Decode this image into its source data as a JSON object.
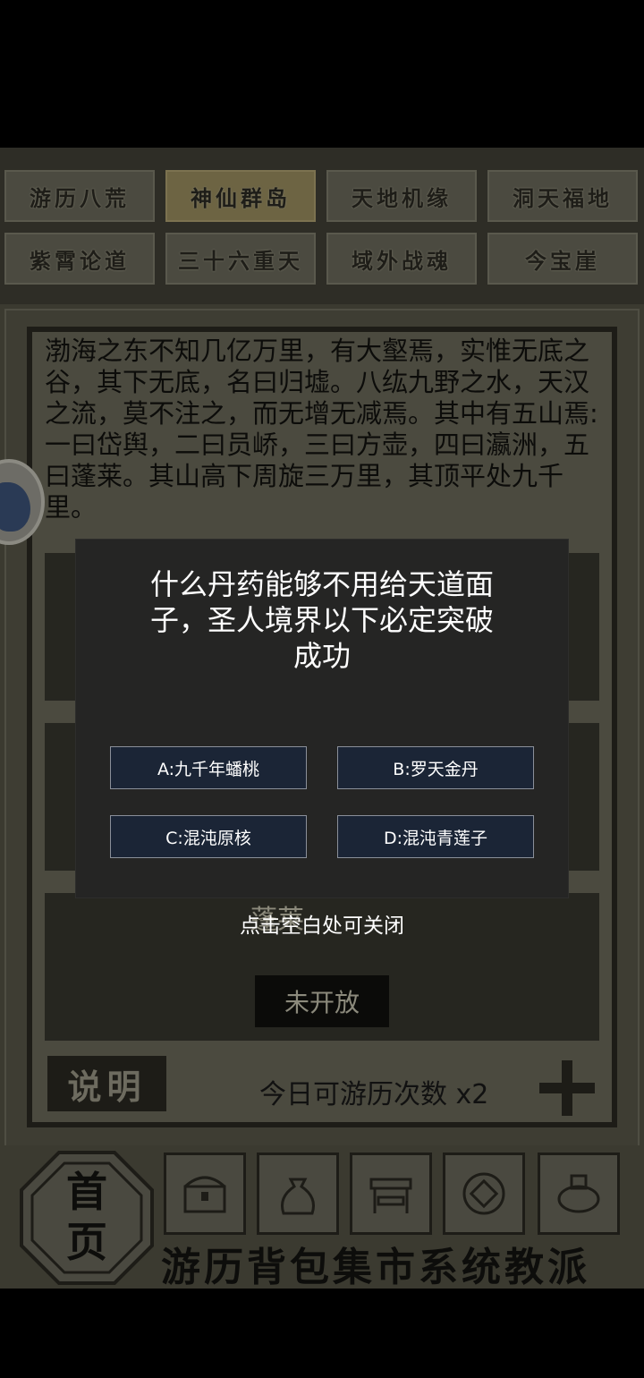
{
  "tabs": [
    {
      "label": "游历八荒"
    },
    {
      "label": "神仙群岛"
    },
    {
      "label": "天地机缘"
    },
    {
      "label": "洞天福地"
    },
    {
      "label": "紫霄论道"
    },
    {
      "label": "三十六重天"
    },
    {
      "label": "域外战魂"
    },
    {
      "label": "今宝崖"
    }
  ],
  "active_tab": "神仙群岛",
  "story_text": "渤海之东不知几亿万里，有大壑焉，实惟无底之谷，其下无底，名曰归墟。八纮九野之水，天汉之流，莫不注之，而无增无减焉。其中有五山焉:一曰岱舆，二曰员峤，三曰方壶，四曰瀛洲，五曰蓬莱。其山高下周旋三万里，其顶平处九千里。",
  "island_card": {
    "title": "蓬莱",
    "status": "未开放"
  },
  "explain_button": "说明",
  "daily_count": "今日可游历次数 x2",
  "home": {
    "line1": "首",
    "line2": "页"
  },
  "nav_labels": "游历背包集市系统教派",
  "nav_items": [
    {
      "name": "chest-icon"
    },
    {
      "name": "bag-icon"
    },
    {
      "name": "market-stall-icon"
    },
    {
      "name": "system-seal-icon"
    },
    {
      "name": "sect-bowl-icon"
    }
  ],
  "dialog": {
    "question": "什么丹药能够不用给天道面子，圣人境界以下必定突破成功",
    "options": {
      "a": "A:九千年蟠桃",
      "b": "B:罗天金丹",
      "c": "C:混沌原核",
      "d": "D:混沌青莲子"
    },
    "close_hint": "点击空白处可关闭"
  }
}
